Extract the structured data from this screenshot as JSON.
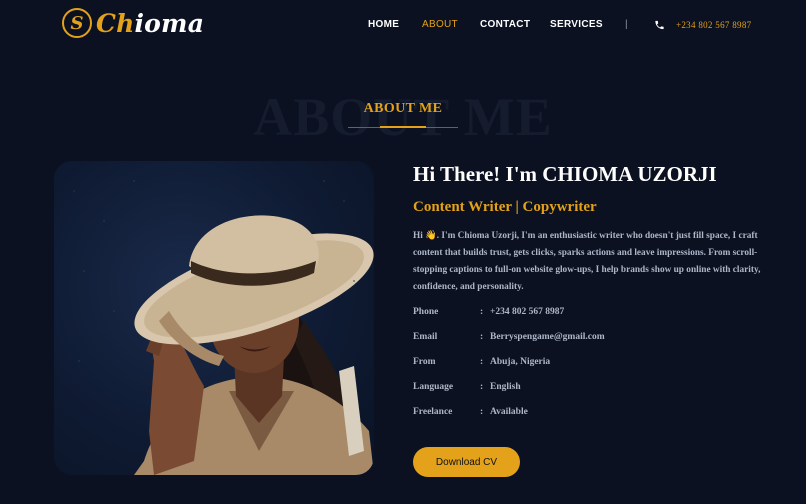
{
  "brand": {
    "mark": "S",
    "name_accent": "Ch",
    "name_rest": "ioma"
  },
  "nav": {
    "items": [
      {
        "label": "HOME",
        "active": false
      },
      {
        "label": "ABOUT",
        "active": true
      },
      {
        "label": "CONTACT",
        "active": false
      },
      {
        "label": "SERVICES",
        "active": false
      }
    ],
    "separator": "|",
    "phone_icon": "phone-icon",
    "phone": "+234 802 567 8987"
  },
  "about": {
    "bg_text": "ABOUT ME",
    "section_title": "ABOUT ME",
    "heading": "Hi There! I'm CHIOMA UZORJI",
    "subheading": "Content Writer | Copywriter",
    "bio_prefix": "Hi",
    "bio_emoji": "👋",
    "bio": ". I'm Chioma Uzorji, I'm an enthusiastic writer who doesn't just fill space, I craft content that builds trust, gets clicks, sparks actions and leave impressions. From scroll-stopping captions to full-on website glow-ups, I help brands show up online with clarity, confidence, and personality.",
    "details": [
      {
        "label": "Phone",
        "value": "+234 802 567 8987"
      },
      {
        "label": "Email",
        "value": "Berryspengame@gmail.com"
      },
      {
        "label": "From",
        "value": "Abuja, Nigeria"
      },
      {
        "label": "Language",
        "value": "English"
      },
      {
        "label": "Freelance",
        "value": "Available"
      }
    ],
    "separator": ":",
    "cv_button": "Download CV",
    "photo_alt": "profile-photo"
  },
  "colors": {
    "accent": "#e3a21a",
    "background": "#0b1120",
    "text_muted": "#aeb6c8"
  }
}
